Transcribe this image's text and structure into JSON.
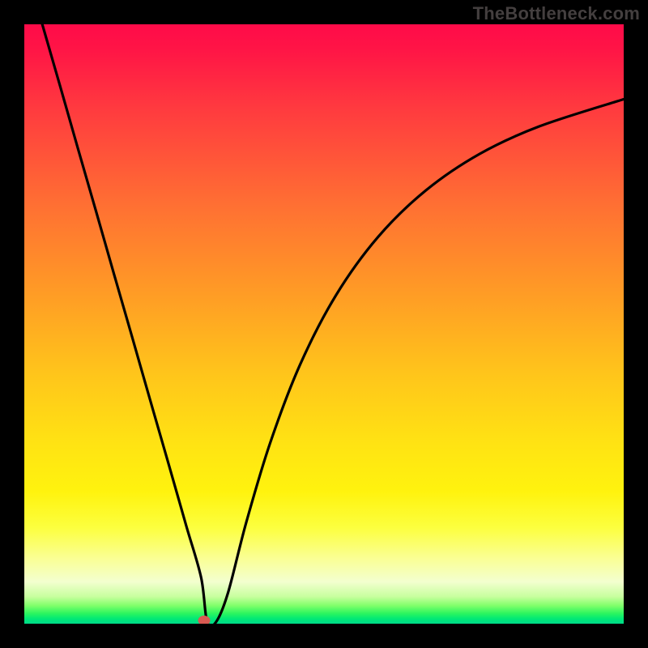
{
  "watermark": "TheBottleneck.com",
  "colors": {
    "background": "#000000",
    "curve": "#000000",
    "marker": "#d95a52"
  },
  "chart_data": {
    "type": "line",
    "title": "",
    "xlabel": "",
    "ylabel": "",
    "xlim": [
      0,
      100
    ],
    "ylim": [
      0,
      100
    ],
    "grid": false,
    "legend": false,
    "annotations": [
      "TheBottleneck.com"
    ],
    "background_gradient_stops": [
      {
        "pos": 0,
        "color": "#ff0b49"
      },
      {
        "pos": 14,
        "color": "#ff3a3f"
      },
      {
        "pos": 30,
        "color": "#ff6f33"
      },
      {
        "pos": 44,
        "color": "#ff9926"
      },
      {
        "pos": 58,
        "color": "#ffc41b"
      },
      {
        "pos": 78,
        "color": "#fff30e"
      },
      {
        "pos": 89,
        "color": "#faff93"
      },
      {
        "pos": 95.5,
        "color": "#c7ff9e"
      },
      {
        "pos": 98.3,
        "color": "#2bf55f"
      },
      {
        "pos": 100,
        "color": "#00db8a"
      }
    ],
    "series": [
      {
        "name": "bottleneck-curve",
        "x": [
          3.0,
          6.0,
          9.0,
          12.0,
          15.0,
          18.0,
          21.0,
          24.0,
          27.0,
          29.5,
          30.5,
          32.0,
          34.0,
          37.0,
          41.0,
          46.0,
          52.0,
          59.0,
          67.0,
          76.0,
          86.0,
          100.0
        ],
        "y": [
          100.0,
          89.6,
          79.1,
          68.7,
          58.2,
          47.8,
          37.3,
          26.9,
          16.4,
          7.7,
          0.3,
          0.3,
          5.2,
          16.8,
          30.1,
          43.2,
          54.8,
          64.5,
          72.3,
          78.4,
          83.0,
          87.5
        ]
      }
    ],
    "marker": {
      "x": 30.0,
      "y": 0.0
    },
    "notes": "V-shaped curve: linearly descending left branch to a minimum near x≈30, then a concave-increasing right branch that asymptotically approaches the top. Axes have no visible ticks or labels. Plot sits inside a solid black border."
  }
}
